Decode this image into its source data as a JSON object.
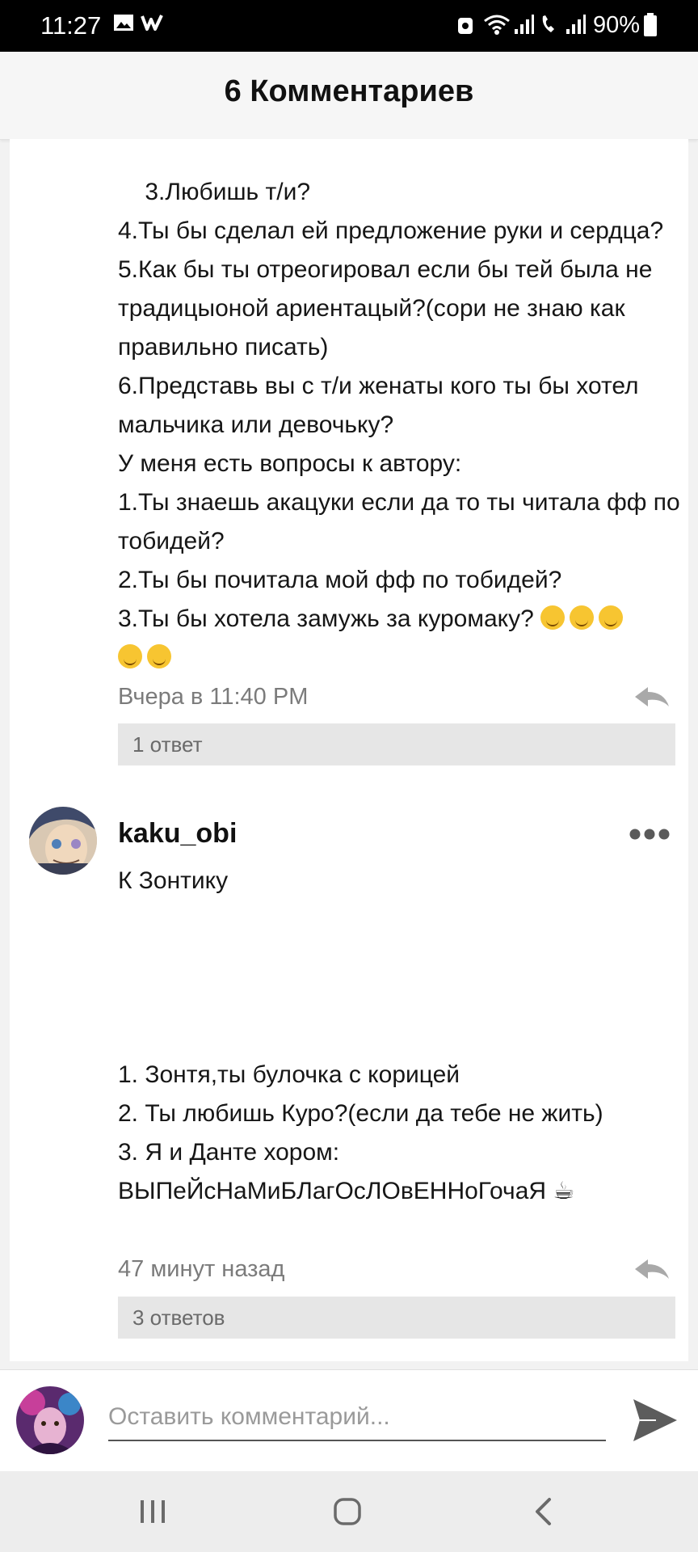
{
  "status_bar": {
    "time": "11:27",
    "battery": "90%"
  },
  "header": {
    "title": "6 Комментариев"
  },
  "comment1": {
    "text": "3.Любишь т/и?\n4.Ты бы сделал ей предложение руки и сердца?\n5.Как бы ты отреогировал если бы тей была не традицыоной ариентацый?(сори не знаю как правильно писать)\n6.Представь вы с т/и женаты кого ты бы хотел мальчика или девочьку?\nУ меня есть вопросы к автору:\n1.Ты знаешь акацуки если да то ты читала фф по тобидей?\n2.Ты бы почитала мой фф по тобидей?\n3.Ты бы хотела замужь за куромаку?",
    "emoji_count": 5,
    "timestamp": "Вчера в 11:40 PM",
    "replies": "1 ответ"
  },
  "comment2": {
    "username": "kaku_obi",
    "text": "К Зонтику\n\n\n\n\n1. Зонтя,ты булочка с корицей\n2. Ты любишь Куро?(если да тебе не жить)\n3. Я и Данте хором:\nВЫПеЙсНаМиБЛагОсЛОвЕННоГочаЯ ☕",
    "timestamp": "47 минут назад",
    "replies": "3 ответов"
  },
  "comment_input": {
    "placeholder": "Оставить комментарий..."
  },
  "colors": {
    "header_bg": "#f6f6f6",
    "reply_bar": "#e6e6e6",
    "meta_text": "#7b7b7b"
  }
}
